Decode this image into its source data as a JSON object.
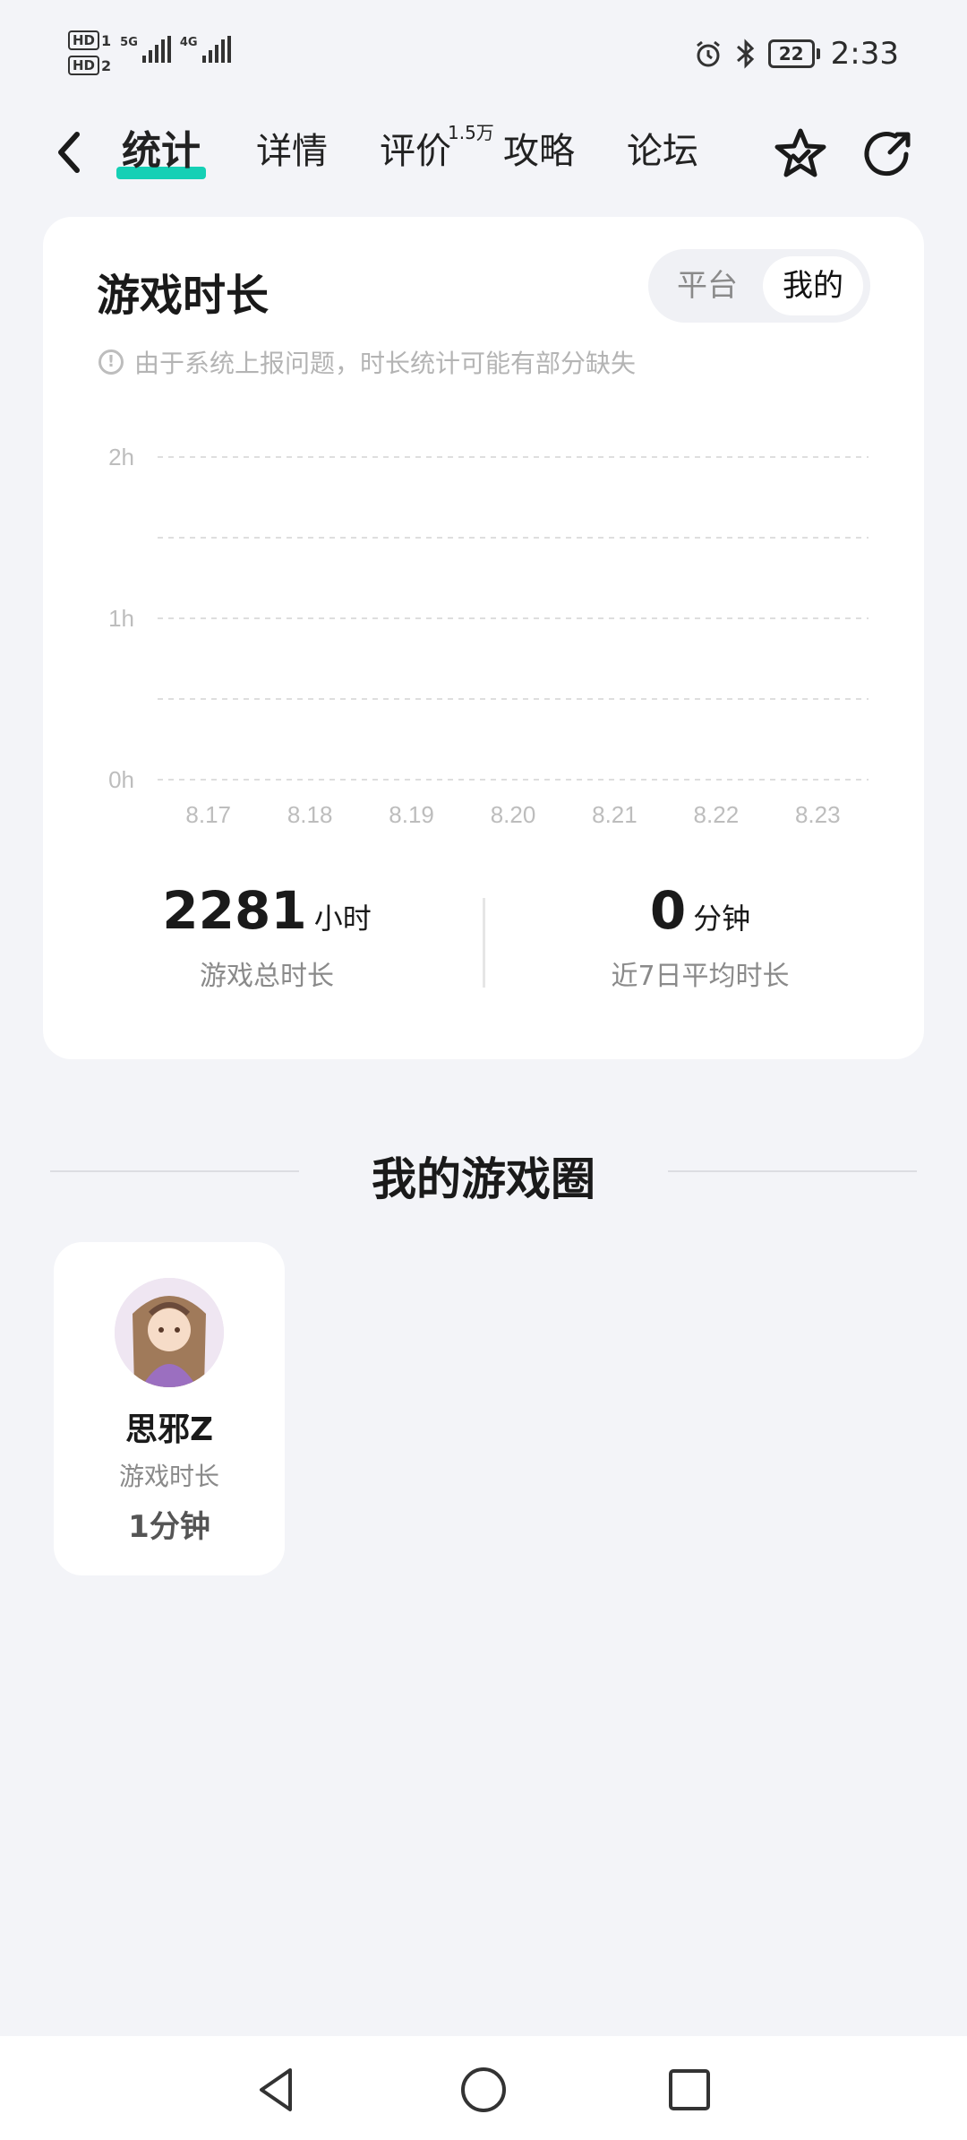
{
  "status_bar": {
    "hd1": "HD",
    "hd1_sub": "1",
    "hd2": "HD",
    "hd2_sub": "2",
    "net1": "5G",
    "net2": "4G",
    "battery": "22",
    "time": "2:33"
  },
  "nav": {
    "tabs": [
      {
        "label": "统计",
        "active": true
      },
      {
        "label": "详情"
      },
      {
        "label": "评价"
      },
      {
        "label": "攻略"
      },
      {
        "label": "论坛"
      }
    ],
    "review_count_badge": "1.5万"
  },
  "card": {
    "title": "游戏时长",
    "toggle": {
      "option1": "平台",
      "option2": "我的",
      "selected": "我的"
    },
    "notice": "由于系统上报问题，时长统计可能有部分缺失",
    "stats": [
      {
        "value": "2281",
        "unit": "小时",
        "label": "游戏总时长"
      },
      {
        "value": "0",
        "unit": "分钟",
        "label": "近7日平均时长"
      }
    ]
  },
  "chart_data": {
    "type": "bar",
    "categories": [
      "8.17",
      "8.18",
      "8.19",
      "8.20",
      "8.21",
      "8.22",
      "8.23"
    ],
    "values": [
      0,
      0,
      0,
      0,
      0,
      0,
      0
    ],
    "ytick_labels": [
      "0h",
      "1h",
      "2h"
    ],
    "ylim": [
      0,
      2
    ],
    "grid": true
  },
  "section": {
    "title": "我的游戏圈",
    "friends": [
      {
        "name": "思邪Z",
        "label": "游戏时长",
        "value": "1分钟"
      }
    ]
  },
  "colors": {
    "accent": "#15d0b5",
    "background": "#f3f4f8"
  }
}
